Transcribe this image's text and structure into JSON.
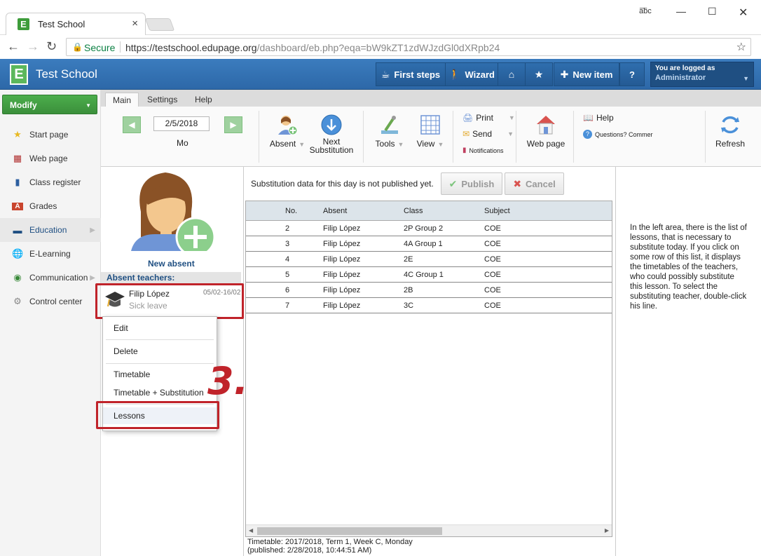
{
  "browser": {
    "tab_title": "Test School",
    "tab_close": "×",
    "favicon_letter": "E",
    "profile_label": "a͞bc",
    "secure_label": "Secure",
    "url_host": "https://testschool.edupage.org",
    "url_path": "/dashboard/eb.php?eqa=bW9kZT1zdWJzdGl0dXRpb24"
  },
  "header": {
    "logo_letter": "E",
    "school_name": "Test School",
    "buttons": [
      {
        "label": "First steps",
        "icon": "book-icon"
      },
      {
        "label": "Wizard",
        "icon": "walker-icon"
      },
      {
        "label": "",
        "icon": "home-icon"
      },
      {
        "label": "",
        "icon": "star-icon"
      },
      {
        "label": "New item",
        "icon": "plus-icon"
      },
      {
        "label": "?",
        "icon": "help-icon"
      }
    ],
    "login_line1": "You are logged as",
    "login_line2": "Administrator"
  },
  "sidebar": {
    "modify_label": "Modify",
    "items": [
      {
        "label": "Start page",
        "icon": "star-icon"
      },
      {
        "label": "Web page",
        "icon": "webpage-icon"
      },
      {
        "label": "Class register",
        "icon": "book-icon"
      },
      {
        "label": "Grades",
        "icon": "grades-icon"
      },
      {
        "label": "Education",
        "icon": "education-icon"
      },
      {
        "label": "E-Learning",
        "icon": "globe-icon"
      },
      {
        "label": "Communication",
        "icon": "communication-icon"
      },
      {
        "label": "Control center",
        "icon": "gear-icon"
      }
    ]
  },
  "ribbon": {
    "tabs": [
      "Main",
      "Settings",
      "Help"
    ],
    "date": "2/5/2018",
    "day": "Mo",
    "absent_label": "Absent",
    "next_label_1": "Next",
    "next_label_2": "Substitution",
    "tools_label": "Tools",
    "view_label": "View",
    "print_label": "Print",
    "send_label": "Send",
    "notifications_label": "Notifications",
    "webpage_label": "Web page",
    "help_label": "Help",
    "questions_label": "Questions? Commer",
    "refresh_label": "Refresh"
  },
  "absent_panel": {
    "new_absent_label": "New absent",
    "header": "Absent teachers:",
    "teacher_name": "Filip López",
    "teacher_reason": "Sick leave",
    "teacher_dates": "05/02-16/02",
    "context_menu": [
      "Edit",
      "Delete",
      "Timetable",
      "Timetable + Substitution",
      "Lessons"
    ],
    "step_number": "3."
  },
  "main": {
    "notice": "Substitution data for this day is not published yet.",
    "publish_label": "Publish",
    "cancel_label": "Cancel",
    "columns": [
      "No.",
      "Absent",
      "Class",
      "Subject"
    ],
    "rows": [
      {
        "no": "2",
        "absent": "Filip López",
        "class": "2P Group 2",
        "subject": "COE"
      },
      {
        "no": "3",
        "absent": "Filip López",
        "class": "4A Group 1",
        "subject": "COE"
      },
      {
        "no": "4",
        "absent": "Filip López",
        "class": "2E",
        "subject": "COE"
      },
      {
        "no": "5",
        "absent": "Filip López",
        "class": "4C Group 1",
        "subject": "COE"
      },
      {
        "no": "6",
        "absent": "Filip López",
        "class": "2B",
        "subject": "COE"
      },
      {
        "no": "7",
        "absent": "Filip López",
        "class": "3C",
        "subject": "COE"
      }
    ],
    "footer_line1": "Timetable: 2017/2018, Term 1, Week C, Monday",
    "footer_line2": "(published: 2/28/2018, 10:44:51 AM)"
  },
  "info": {
    "text": "In the left area, there is the list of lessons, that is necessary to substitute today. If you click on some row of this list, it displays the timetables of the teachers, who could possibly substitute this lesson. To select the substituting teacher, double-click his line."
  },
  "colors": {
    "header_blue": "#2d68a8",
    "modify_green": "#3b8f3b",
    "annotation_red": "#c0232a"
  }
}
